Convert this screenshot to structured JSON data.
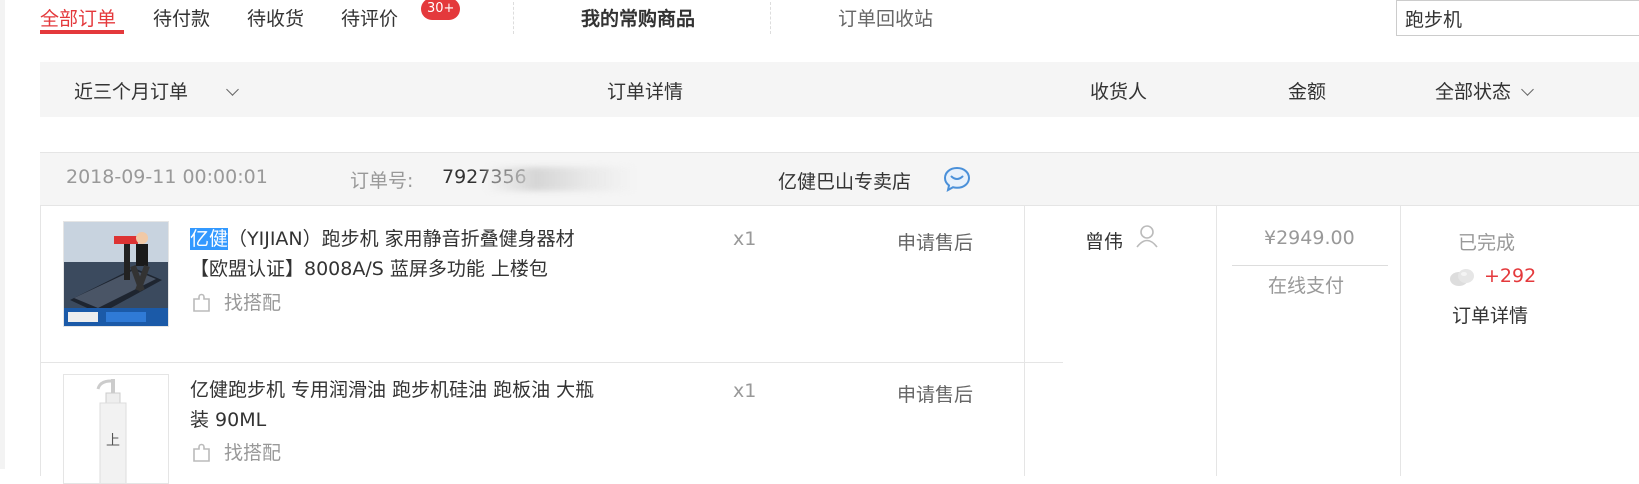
{
  "tabs": {
    "all_orders": "全部订单",
    "pending_payment": "待付款",
    "pending_receipt": "待收货",
    "pending_review": "待评价",
    "review_badge": "30+",
    "frequent_items": "我的常购商品",
    "recycle_bin": "订单回收站"
  },
  "search": {
    "value": "跑步机"
  },
  "table_header": {
    "period_filter": "近三个月订单",
    "order_details": "订单详情",
    "recipient": "收货人",
    "amount": "金额",
    "status_filter": "全部状态"
  },
  "order": {
    "date": "2018-09-11 00:00:01",
    "order_no_label": "订单号:",
    "order_no_value": "7927356",
    "shop_name": "亿健巴山专卖店",
    "items": [
      {
        "title_highlight": "亿健",
        "title_rest": "（YIJIAN）跑步机 家用静音折叠健身器材 【欧盟认证】8008A/S 蓝屏多功能 上楼包",
        "quantity": "x1",
        "after_sale": "申请售后",
        "find_match": "找搭配"
      },
      {
        "title": "亿健跑步机 专用润滑油 跑步机硅油 跑板油 大瓶装 90ML",
        "quantity": "x1",
        "after_sale": "申请售后",
        "find_match": "找搭配"
      }
    ],
    "recipient": "曾伟",
    "amount": "¥2949.00",
    "payment_method": "在线支付",
    "status": "已完成",
    "bean_reward": "+292",
    "detail_link": "订单详情"
  },
  "colors": {
    "accent": "#e4393c",
    "muted": "#999999",
    "header_bg": "#f5f5f5"
  }
}
